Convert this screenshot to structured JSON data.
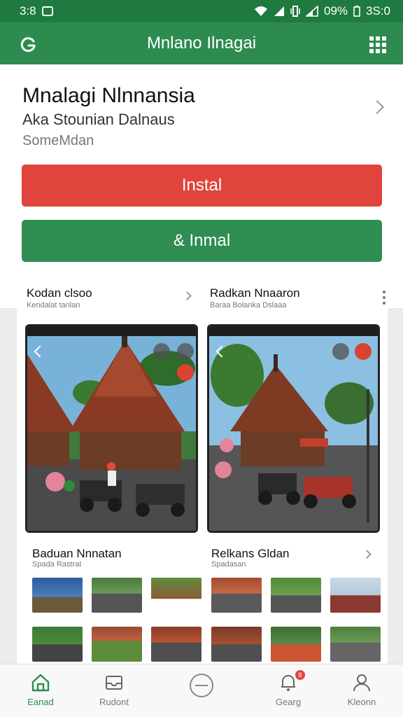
{
  "status_bar": {
    "time": "3:8",
    "battery": "09%",
    "clock": "3S:0"
  },
  "app_bar": {
    "title": "Mnlano Ilnagai"
  },
  "header": {
    "app_name": "Mnalagi Nlnnansia",
    "subtitle": "Aka Stounian Dalnaus",
    "category": "SomeMdan"
  },
  "buttons": {
    "install": "Instal",
    "uninstall": "& Inmal"
  },
  "gallery": {
    "left": {
      "title": "Kodan clsoo",
      "subtitle": "Kendalat tanlan",
      "section_title": "Baduan Nnnatan",
      "section_subtitle": "Spada Rastrat"
    },
    "right": {
      "title": "Radkan Nnaaron",
      "subtitle": "Baraa Bolanka Dslaaa",
      "section_title": "Relkans Gldan",
      "section_subtitle": "Spadasan"
    }
  },
  "bottom_nav": {
    "items": [
      {
        "label": "Eanad",
        "icon": "home-icon",
        "active": true
      },
      {
        "label": "Rudont",
        "icon": "inbox-icon",
        "active": false
      },
      {
        "label": "",
        "icon": "add-circle-icon",
        "active": false
      },
      {
        "label": "Gearg",
        "icon": "notification-icon",
        "active": false,
        "badge": "8"
      },
      {
        "label": "Kleonn",
        "icon": "profile-icon",
        "active": false
      }
    ]
  },
  "colors": {
    "status_bar": "#1f7a3f",
    "app_bar": "#2e8b50",
    "install_button": "#e0443c",
    "uninstall_button": "#2f8d52"
  }
}
